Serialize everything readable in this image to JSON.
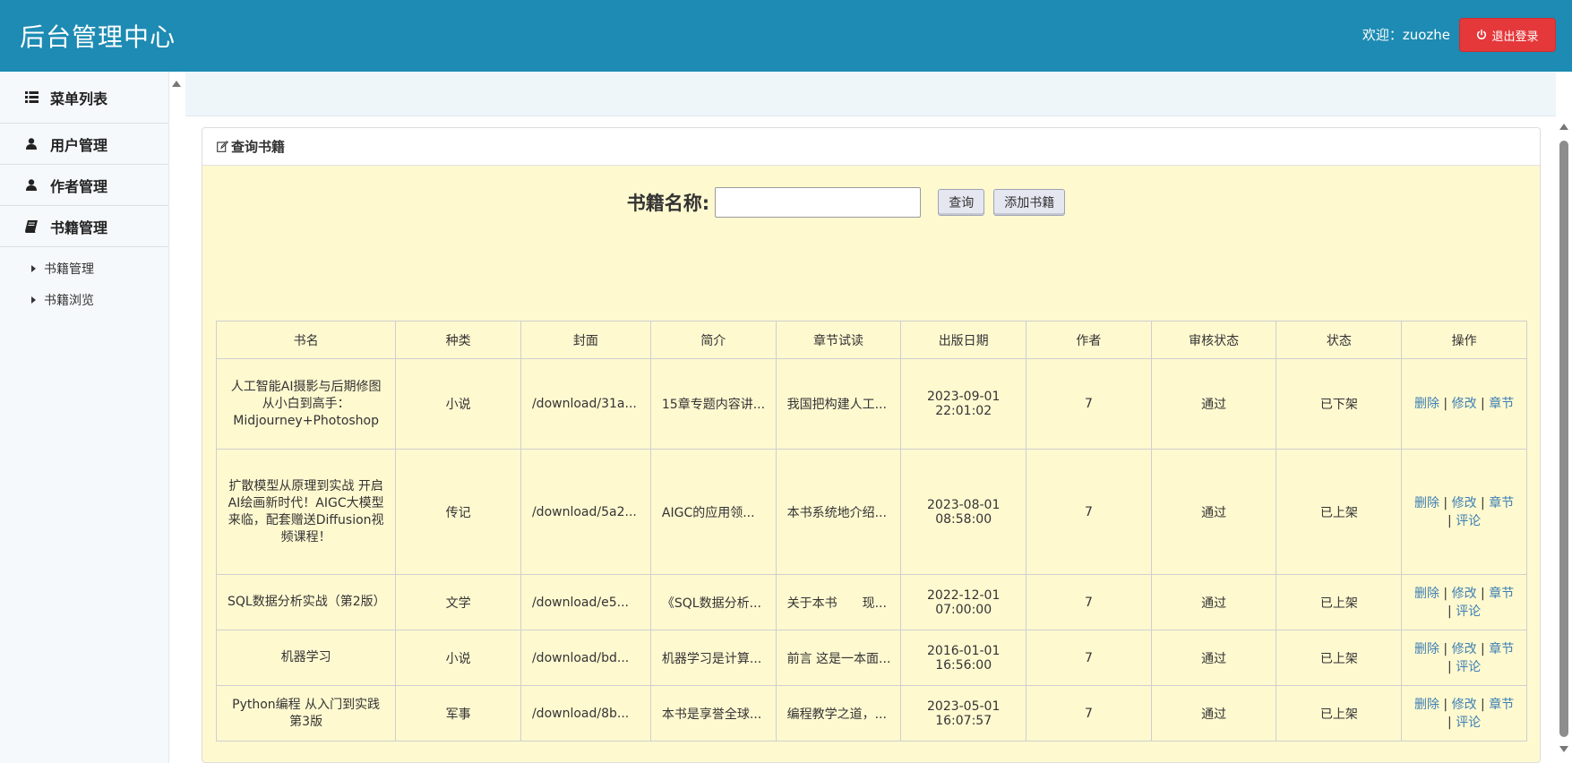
{
  "header": {
    "title": "后台管理中心",
    "welcome": "欢迎：zuozhe",
    "logout_label": "退出登录",
    "bg_color": "#1d8bb3",
    "logout_color": "#e5383b"
  },
  "sidebar": {
    "menu_title": "菜单列表",
    "items": [
      {
        "label": "用户管理",
        "icon": "user-icon"
      },
      {
        "label": "作者管理",
        "icon": "user-icon"
      },
      {
        "label": "书籍管理",
        "icon": "book-icon"
      }
    ],
    "sub_items": [
      {
        "label": "书籍管理"
      },
      {
        "label": "书籍浏览"
      }
    ]
  },
  "panel": {
    "title": "查询书籍",
    "search_label": "书籍名称:",
    "search_value": "",
    "search_placeholder": "",
    "query_button": "查询",
    "add_button": "添加书籍"
  },
  "table": {
    "headers": [
      "书名",
      "种类",
      "封面",
      "简介",
      "章节试读",
      "出版日期",
      "作者",
      "审核状态",
      "状态",
      "操作"
    ],
    "rows": [
      {
        "name": "人工智能AI摄影与后期修图从小白到高手：Midjourney+Photoshop",
        "category": "小说",
        "cover": "/download/31a...",
        "intro": "15章专题内容讲...",
        "chapter": "我国把构建人工...",
        "date": "2023-09-01",
        "time": "22:01:02",
        "author": "7",
        "review": "通过",
        "status": "已下架",
        "ops": {
          "delete": "删除",
          "edit": "修改",
          "chapter": "章节",
          "comment": ""
        }
      },
      {
        "name": "扩散模型从原理到实战 开启AI绘画新时代！AIGC大模型来临，配套赠送Diffusion视频课程！",
        "category": "传记",
        "cover": "/download/5a2...",
        "intro": "AIGC的应用领...",
        "chapter": "本书系统地介绍...",
        "date": "2023-08-01",
        "time": "08:58:00",
        "author": "7",
        "review": "通过",
        "status": "已上架",
        "ops": {
          "delete": "删除",
          "edit": "修改",
          "chapter": "章节",
          "comment": "评论"
        }
      },
      {
        "name": "SQL数据分析实战（第2版）",
        "category": "文学",
        "cover": "/download/e5...",
        "intro": "《SQL数据分析...",
        "chapter": "关于本书　　现...",
        "date": "2022-12-01",
        "time": "07:00:00",
        "author": "7",
        "review": "通过",
        "status": "已上架",
        "ops": {
          "delete": "删除",
          "edit": "修改",
          "chapter": "章节",
          "comment": "评论"
        }
      },
      {
        "name": "机器学习",
        "category": "小说",
        "cover": "/download/bd...",
        "intro": "机器学习是计算...",
        "chapter": "前言 这是一本面...",
        "date": "2016-01-01",
        "time": "16:56:00",
        "author": "7",
        "review": "通过",
        "status": "已上架",
        "ops": {
          "delete": "删除",
          "edit": "修改",
          "chapter": "章节",
          "comment": "评论"
        }
      },
      {
        "name": "Python编程 从入门到实践 第3版",
        "category": "军事",
        "cover": "/download/8b...",
        "intro": "本书是享誉全球...",
        "chapter": "编程教学之道，...",
        "date": "2023-05-01",
        "time": "16:07:57",
        "author": "7",
        "review": "通过",
        "status": "已上架",
        "ops": {
          "delete": "删除",
          "edit": "修改",
          "chapter": "章节",
          "comment": "评论"
        }
      }
    ]
  }
}
